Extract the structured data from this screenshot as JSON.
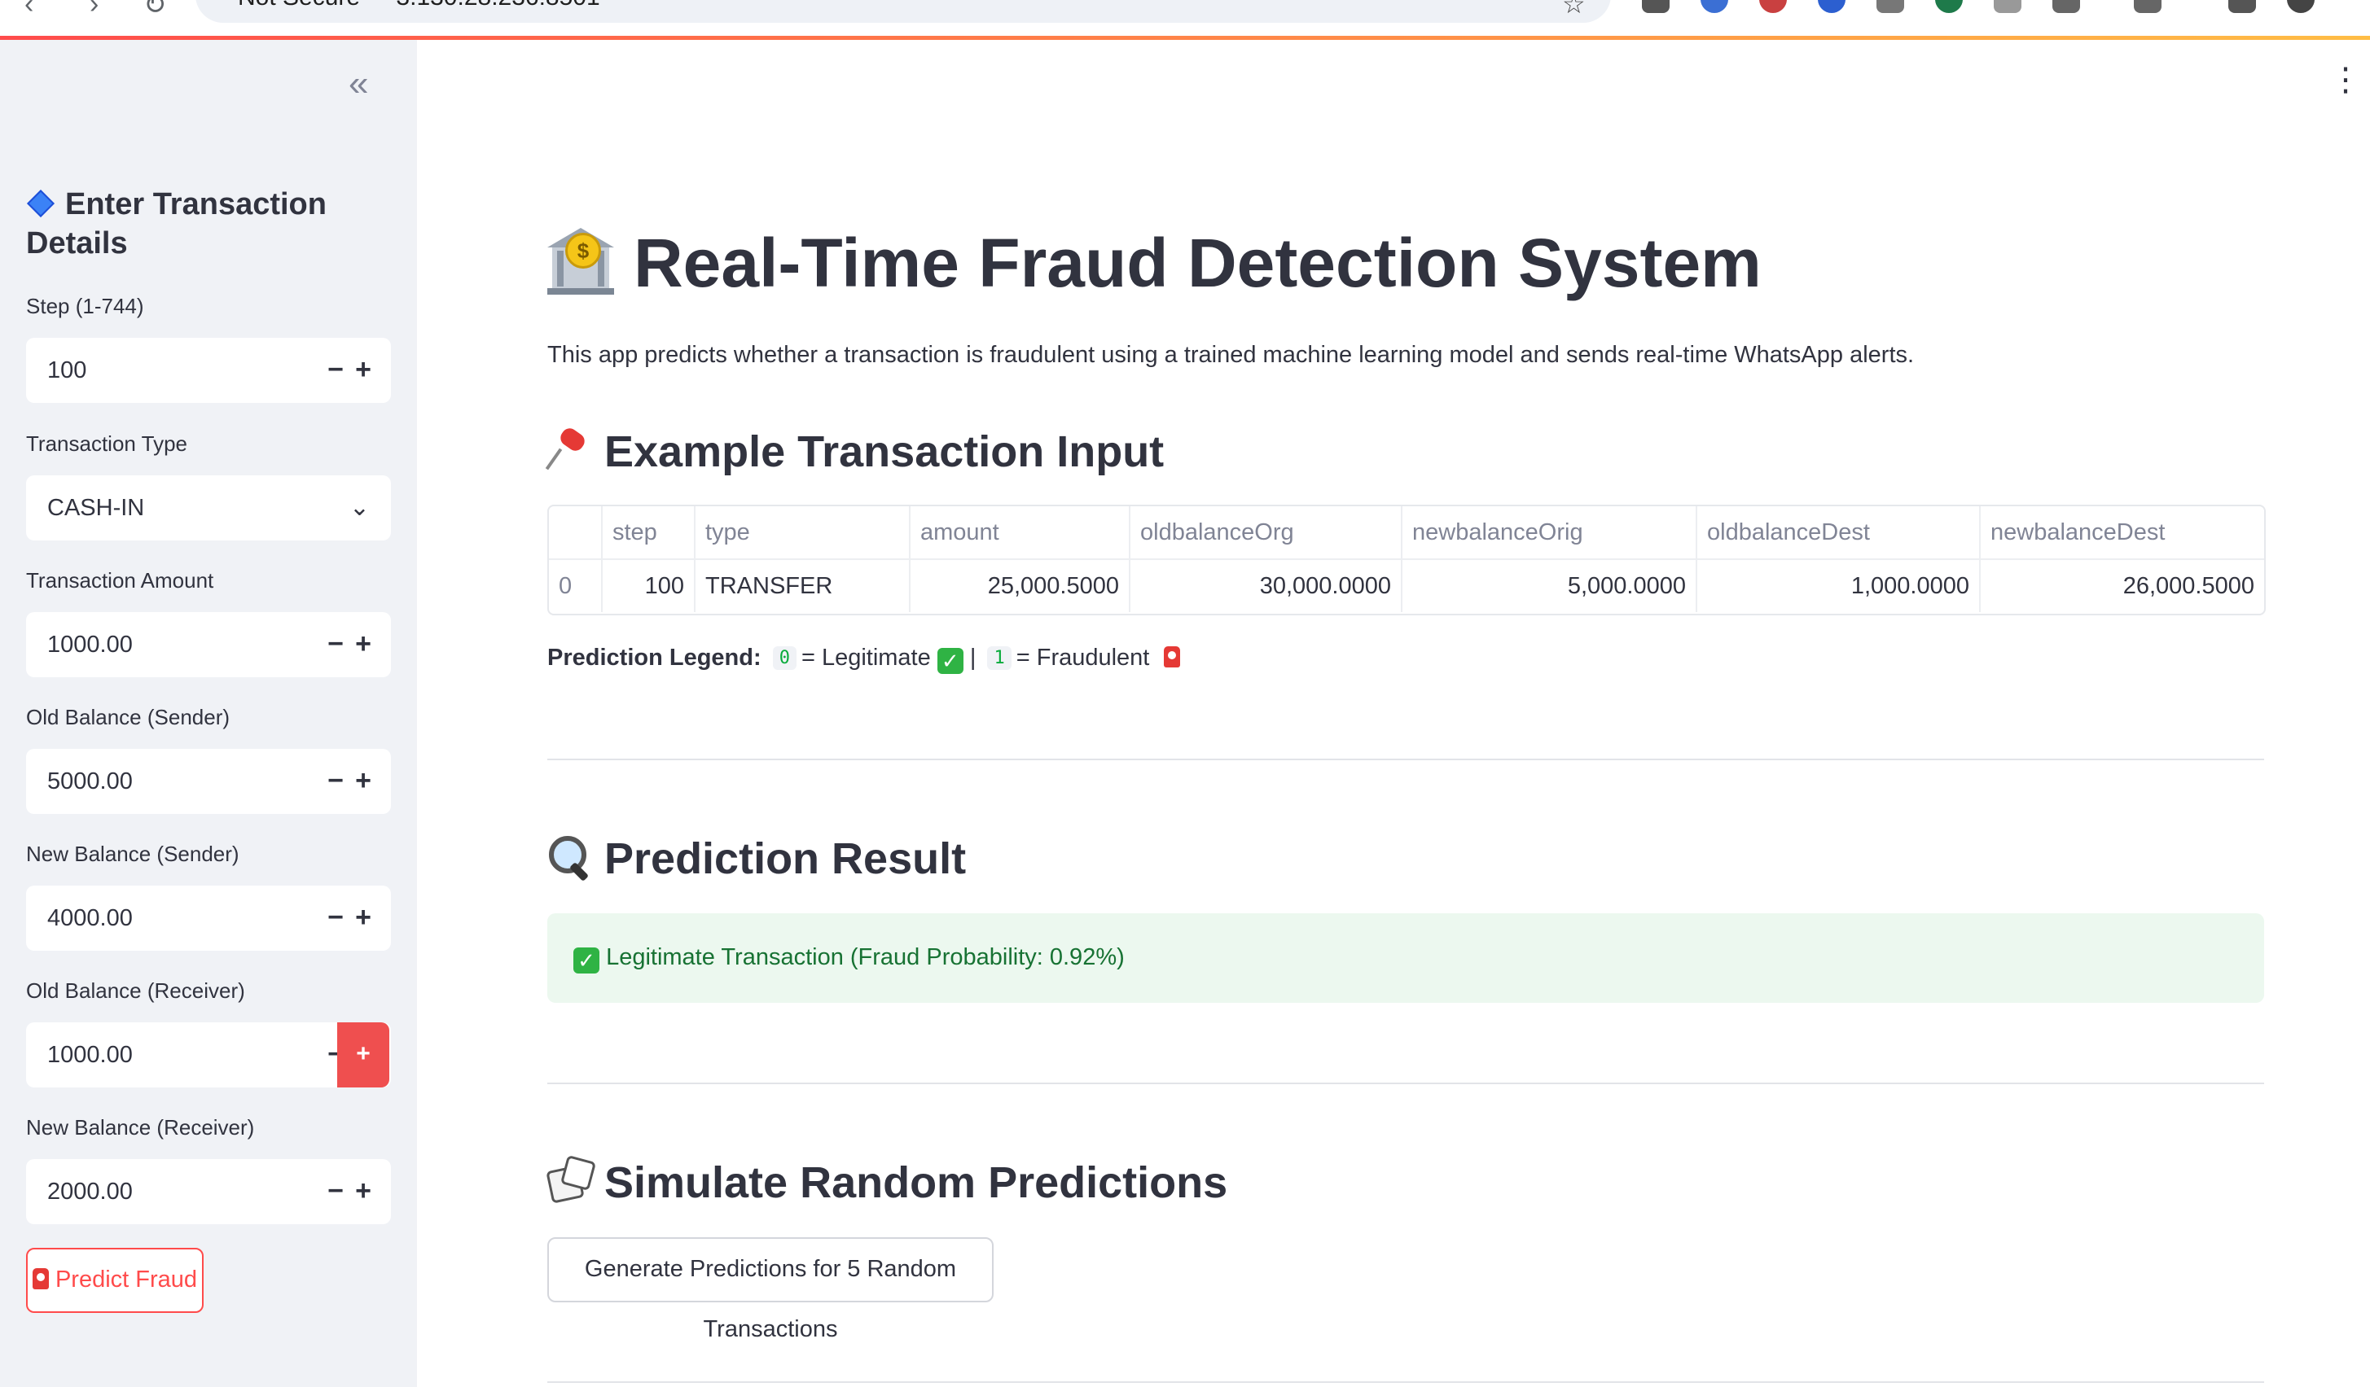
{
  "browser": {
    "security_label": "Not Secure",
    "url": "3.130.28.236:8501"
  },
  "colors": {
    "accent": "#ff4b4b",
    "sidebar_bg": "#f0f2f6",
    "success_bg": "#ecf8ef",
    "success_text": "#177233"
  },
  "sidebar": {
    "collapse_icon": "double-chevron-left-icon",
    "header": "Enter Transaction Details",
    "fields": [
      {
        "label": "Step (1-744)",
        "value": "100",
        "type": "number"
      },
      {
        "label": "Transaction Type",
        "value": "CASH-IN",
        "type": "select"
      },
      {
        "label": "Transaction Amount",
        "value": "1000.00",
        "type": "number"
      },
      {
        "label": "Old Balance (Sender)",
        "value": "5000.00",
        "type": "number"
      },
      {
        "label": "New Balance (Sender)",
        "value": "4000.00",
        "type": "number"
      },
      {
        "label": "Old Balance (Receiver)",
        "value": "1000.00",
        "type": "number"
      },
      {
        "label": "New Balance (Receiver)",
        "value": "2000.00",
        "type": "number"
      }
    ],
    "minus_label": "−",
    "plus_label": "+",
    "predict_button": "Predict Fraud"
  },
  "main": {
    "title": "Real-Time Fraud Detection System",
    "subtitle": "This app predicts whether a transaction is fraudulent using a trained machine learning model and sends real-time WhatsApp alerts.",
    "example_header": "Example Transaction Input",
    "table": {
      "columns": [
        "",
        "step",
        "type",
        "amount",
        "oldbalanceOrg",
        "newbalanceOrig",
        "oldbalanceDest",
        "newbalanceDest"
      ],
      "rows": [
        [
          "0",
          "100",
          "TRANSFER",
          "25,000.5000",
          "30,000.0000",
          "5,000.0000",
          "1,000.0000",
          "26,000.5000"
        ]
      ]
    },
    "legend": {
      "label": "Prediction Legend:",
      "zero_code": "0",
      "zero_text": "= Legitimate",
      "separator": "|",
      "one_code": "1",
      "one_text": "= Fraudulent"
    },
    "result_header": "Prediction Result",
    "result_text": "Legitimate Transaction (Fraud Probability: 0.92%)",
    "simulate_header": "Simulate Random Predictions",
    "simulate_button": "Generate Predictions for 5 Random Transactions"
  }
}
